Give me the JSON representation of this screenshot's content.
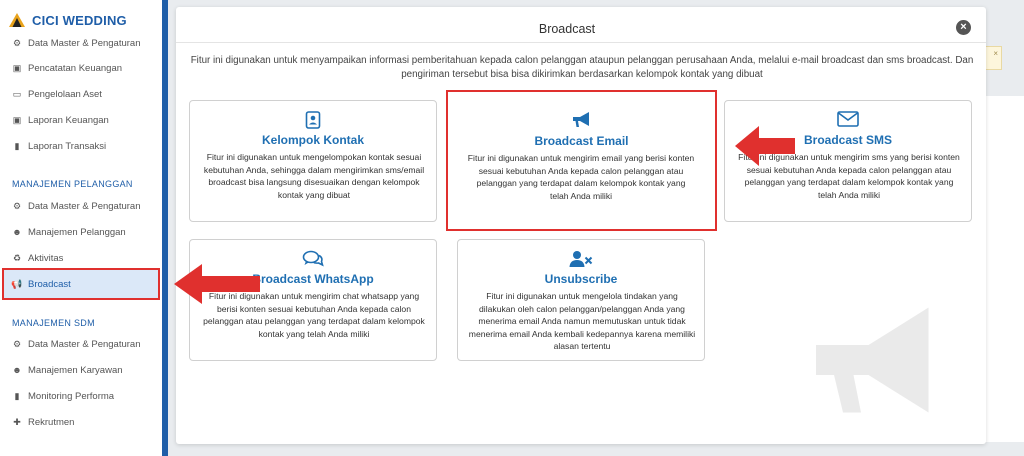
{
  "brand": {
    "name": "CICI WEDDING"
  },
  "sidebar": {
    "top_items": [
      {
        "label": "Data Master & Pengaturan",
        "icon": "gears-icon"
      },
      {
        "label": "Pencatatan Keuangan",
        "icon": "money-icon"
      },
      {
        "label": "Pengelolaan Aset",
        "icon": "hdd-icon"
      },
      {
        "label": "Laporan Keuangan",
        "icon": "money-icon"
      },
      {
        "label": "Laporan Transaksi",
        "icon": "book-icon"
      }
    ],
    "section_pelanggan": "MANAJEMEN PELANGGAN",
    "pelanggan_items": [
      {
        "label": "Data Master & Pengaturan",
        "icon": "gears-icon"
      },
      {
        "label": "Manajemen Pelanggan",
        "icon": "users-icon"
      },
      {
        "label": "Aktivitas",
        "icon": "recycle-icon"
      },
      {
        "label": "Broadcast",
        "icon": "bullhorn-icon"
      }
    ],
    "section_sdm": "MANAJEMEN SDM",
    "sdm_items": [
      {
        "label": "Data Master & Pengaturan",
        "icon": "gears-icon"
      },
      {
        "label": "Manajemen Karyawan",
        "icon": "users-icon"
      },
      {
        "label": "Monitoring Performa",
        "icon": "book-icon"
      },
      {
        "label": "Rekrutmen",
        "icon": "user-plus-icon"
      }
    ]
  },
  "modal": {
    "title": "Broadcast",
    "description": "Fitur ini digunakan untuk menyampaikan informasi pemberitahuan kepada calon pelanggan ataupun pelanggan perusahaan Anda, melalui e-mail broadcast dan sms broadcast. Dan pengiriman tersebut bisa bisa dikirimkan berdasarkan kelompok kontak yang dibuat",
    "cards": [
      {
        "title": "Kelompok Kontak",
        "icon": "address-book-icon",
        "desc": "Fitur ini digunakan untuk mengelompokan kontak sesuai kebutuhan Anda, sehingga dalam mengirimkan sms/email broadcast bisa langsung disesuaikan dengan kelompok kontak yang dibuat"
      },
      {
        "title": "Broadcast Email",
        "icon": "bullhorn-icon",
        "desc": "Fitur ini digunakan untuk mengirim email yang berisi konten sesuai kebutuhan Anda kepada calon pelanggan atau pelanggan yang terdapat dalam kelompok kontak yang telah Anda miliki"
      },
      {
        "title": "Broadcast SMS",
        "icon": "envelope-icon",
        "desc": "Fitur ini digunakan untuk mengirim sms yang berisi konten sesuai kebutuhan Anda kepada calon pelanggan atau pelanggan yang terdapat dalam kelompok kontak yang telah Anda miliki"
      },
      {
        "title": "Broadcast WhatsApp",
        "icon": "comments-icon",
        "desc": "Fitur ini digunakan untuk mengirim chat whatsapp yang berisi konten sesuai kebutuhan Anda kepada calon pelanggan atau pelanggan yang terdapat dalam kelompok kontak yang telah Anda miliki"
      },
      {
        "title": "Unsubscribe",
        "icon": "user-times-icon",
        "desc": "Fitur ini digunakan untuk mengelola tindakan yang dilakukan oleh calon pelanggan/pelanggan Anda yang menerima email Anda namun memutuskan untuk tidak menerima email Anda kembali kedepannya karena memiliki alasan tertentu"
      }
    ]
  },
  "alert": {
    "close_glyph": "×"
  },
  "colors": {
    "primary": "#1f5ea8",
    "accent_red": "#e0302e",
    "card_title": "#1f6fb2"
  }
}
